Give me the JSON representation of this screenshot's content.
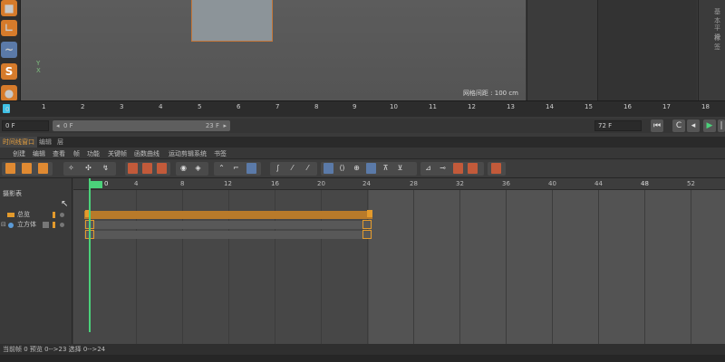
{
  "viewport": {
    "axis_label": "Y\nX",
    "grid_spacing": "网格间距 : 100 cm"
  },
  "right_panel": {
    "line1": "基本",
    "line2": "坐标",
    "line3": "平滑",
    "line4": "标签"
  },
  "ruler": {
    "frames": [
      "0",
      "1",
      "2",
      "3",
      "4",
      "5",
      "6",
      "7",
      "8",
      "9",
      "10",
      "11",
      "12",
      "13",
      "14",
      "15",
      "16",
      "17",
      "18"
    ]
  },
  "transport": {
    "start_field": "0 F",
    "range_start": "0 F",
    "range_end": "23 F",
    "end_field": "72 F"
  },
  "timeline": {
    "tabs": [
      "时间线窗口",
      "编辑",
      "层"
    ],
    "menu": [
      "创建",
      "编辑",
      "查看",
      "帧",
      "功能",
      "关键帧",
      "函数曲线",
      "运动剪辑系统",
      "书签"
    ],
    "ruler_labels": [
      "0",
      "4",
      "8",
      "12",
      "16",
      "20",
      "24",
      "28",
      "32",
      "36",
      "40",
      "44",
      "48",
      "52"
    ],
    "left_header": "摄影表",
    "rows": [
      {
        "label": "总览"
      },
      {
        "label": "立方体"
      }
    ],
    "current_frame": "0"
  },
  "status": {
    "text": "当前帧  0  预览  0-->23  选择  0-->24"
  },
  "colors": {
    "accent": "#e39a2c",
    "playhead": "#4bd17a",
    "ruler_head": "#3ec1e6"
  }
}
